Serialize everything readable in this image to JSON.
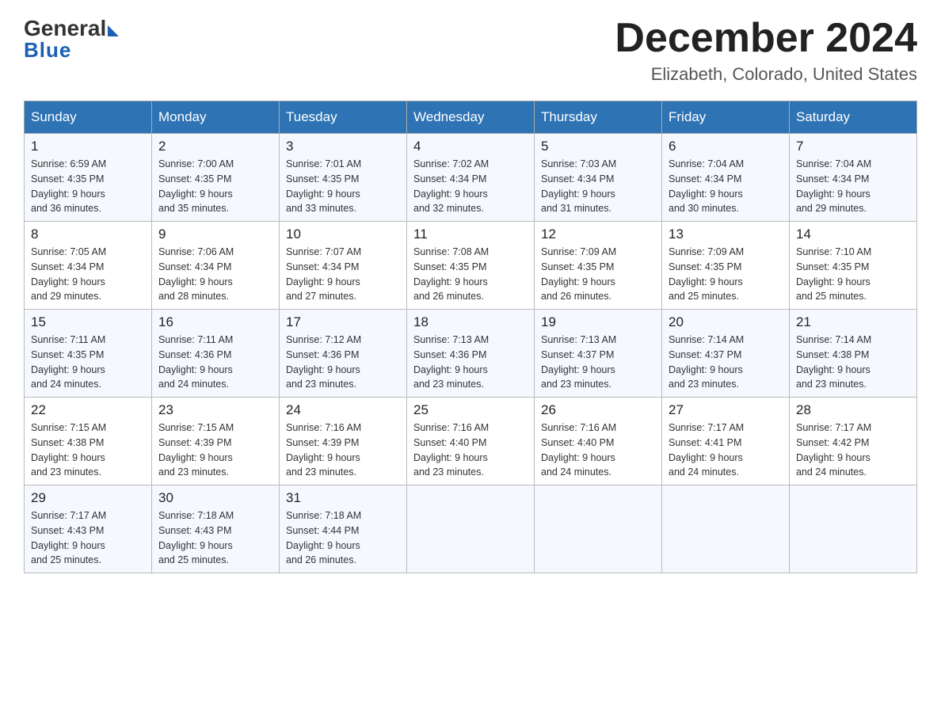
{
  "header": {
    "logo": {
      "general": "General",
      "blue": "Blue"
    },
    "title": "December 2024",
    "location": "Elizabeth, Colorado, United States"
  },
  "weekdays": [
    "Sunday",
    "Monday",
    "Tuesday",
    "Wednesday",
    "Thursday",
    "Friday",
    "Saturday"
  ],
  "weeks": [
    [
      {
        "day": "1",
        "sunrise": "Sunrise: 6:59 AM",
        "sunset": "Sunset: 4:35 PM",
        "daylight": "Daylight: 9 hours",
        "daylight2": "and 36 minutes."
      },
      {
        "day": "2",
        "sunrise": "Sunrise: 7:00 AM",
        "sunset": "Sunset: 4:35 PM",
        "daylight": "Daylight: 9 hours",
        "daylight2": "and 35 minutes."
      },
      {
        "day": "3",
        "sunrise": "Sunrise: 7:01 AM",
        "sunset": "Sunset: 4:35 PM",
        "daylight": "Daylight: 9 hours",
        "daylight2": "and 33 minutes."
      },
      {
        "day": "4",
        "sunrise": "Sunrise: 7:02 AM",
        "sunset": "Sunset: 4:34 PM",
        "daylight": "Daylight: 9 hours",
        "daylight2": "and 32 minutes."
      },
      {
        "day": "5",
        "sunrise": "Sunrise: 7:03 AM",
        "sunset": "Sunset: 4:34 PM",
        "daylight": "Daylight: 9 hours",
        "daylight2": "and 31 minutes."
      },
      {
        "day": "6",
        "sunrise": "Sunrise: 7:04 AM",
        "sunset": "Sunset: 4:34 PM",
        "daylight": "Daylight: 9 hours",
        "daylight2": "and 30 minutes."
      },
      {
        "day": "7",
        "sunrise": "Sunrise: 7:04 AM",
        "sunset": "Sunset: 4:34 PM",
        "daylight": "Daylight: 9 hours",
        "daylight2": "and 29 minutes."
      }
    ],
    [
      {
        "day": "8",
        "sunrise": "Sunrise: 7:05 AM",
        "sunset": "Sunset: 4:34 PM",
        "daylight": "Daylight: 9 hours",
        "daylight2": "and 29 minutes."
      },
      {
        "day": "9",
        "sunrise": "Sunrise: 7:06 AM",
        "sunset": "Sunset: 4:34 PM",
        "daylight": "Daylight: 9 hours",
        "daylight2": "and 28 minutes."
      },
      {
        "day": "10",
        "sunrise": "Sunrise: 7:07 AM",
        "sunset": "Sunset: 4:34 PM",
        "daylight": "Daylight: 9 hours",
        "daylight2": "and 27 minutes."
      },
      {
        "day": "11",
        "sunrise": "Sunrise: 7:08 AM",
        "sunset": "Sunset: 4:35 PM",
        "daylight": "Daylight: 9 hours",
        "daylight2": "and 26 minutes."
      },
      {
        "day": "12",
        "sunrise": "Sunrise: 7:09 AM",
        "sunset": "Sunset: 4:35 PM",
        "daylight": "Daylight: 9 hours",
        "daylight2": "and 26 minutes."
      },
      {
        "day": "13",
        "sunrise": "Sunrise: 7:09 AM",
        "sunset": "Sunset: 4:35 PM",
        "daylight": "Daylight: 9 hours",
        "daylight2": "and 25 minutes."
      },
      {
        "day": "14",
        "sunrise": "Sunrise: 7:10 AM",
        "sunset": "Sunset: 4:35 PM",
        "daylight": "Daylight: 9 hours",
        "daylight2": "and 25 minutes."
      }
    ],
    [
      {
        "day": "15",
        "sunrise": "Sunrise: 7:11 AM",
        "sunset": "Sunset: 4:35 PM",
        "daylight": "Daylight: 9 hours",
        "daylight2": "and 24 minutes."
      },
      {
        "day": "16",
        "sunrise": "Sunrise: 7:11 AM",
        "sunset": "Sunset: 4:36 PM",
        "daylight": "Daylight: 9 hours",
        "daylight2": "and 24 minutes."
      },
      {
        "day": "17",
        "sunrise": "Sunrise: 7:12 AM",
        "sunset": "Sunset: 4:36 PM",
        "daylight": "Daylight: 9 hours",
        "daylight2": "and 23 minutes."
      },
      {
        "day": "18",
        "sunrise": "Sunrise: 7:13 AM",
        "sunset": "Sunset: 4:36 PM",
        "daylight": "Daylight: 9 hours",
        "daylight2": "and 23 minutes."
      },
      {
        "day": "19",
        "sunrise": "Sunrise: 7:13 AM",
        "sunset": "Sunset: 4:37 PM",
        "daylight": "Daylight: 9 hours",
        "daylight2": "and 23 minutes."
      },
      {
        "day": "20",
        "sunrise": "Sunrise: 7:14 AM",
        "sunset": "Sunset: 4:37 PM",
        "daylight": "Daylight: 9 hours",
        "daylight2": "and 23 minutes."
      },
      {
        "day": "21",
        "sunrise": "Sunrise: 7:14 AM",
        "sunset": "Sunset: 4:38 PM",
        "daylight": "Daylight: 9 hours",
        "daylight2": "and 23 minutes."
      }
    ],
    [
      {
        "day": "22",
        "sunrise": "Sunrise: 7:15 AM",
        "sunset": "Sunset: 4:38 PM",
        "daylight": "Daylight: 9 hours",
        "daylight2": "and 23 minutes."
      },
      {
        "day": "23",
        "sunrise": "Sunrise: 7:15 AM",
        "sunset": "Sunset: 4:39 PM",
        "daylight": "Daylight: 9 hours",
        "daylight2": "and 23 minutes."
      },
      {
        "day": "24",
        "sunrise": "Sunrise: 7:16 AM",
        "sunset": "Sunset: 4:39 PM",
        "daylight": "Daylight: 9 hours",
        "daylight2": "and 23 minutes."
      },
      {
        "day": "25",
        "sunrise": "Sunrise: 7:16 AM",
        "sunset": "Sunset: 4:40 PM",
        "daylight": "Daylight: 9 hours",
        "daylight2": "and 23 minutes."
      },
      {
        "day": "26",
        "sunrise": "Sunrise: 7:16 AM",
        "sunset": "Sunset: 4:40 PM",
        "daylight": "Daylight: 9 hours",
        "daylight2": "and 24 minutes."
      },
      {
        "day": "27",
        "sunrise": "Sunrise: 7:17 AM",
        "sunset": "Sunset: 4:41 PM",
        "daylight": "Daylight: 9 hours",
        "daylight2": "and 24 minutes."
      },
      {
        "day": "28",
        "sunrise": "Sunrise: 7:17 AM",
        "sunset": "Sunset: 4:42 PM",
        "daylight": "Daylight: 9 hours",
        "daylight2": "and 24 minutes."
      }
    ],
    [
      {
        "day": "29",
        "sunrise": "Sunrise: 7:17 AM",
        "sunset": "Sunset: 4:43 PM",
        "daylight": "Daylight: 9 hours",
        "daylight2": "and 25 minutes."
      },
      {
        "day": "30",
        "sunrise": "Sunrise: 7:18 AM",
        "sunset": "Sunset: 4:43 PM",
        "daylight": "Daylight: 9 hours",
        "daylight2": "and 25 minutes."
      },
      {
        "day": "31",
        "sunrise": "Sunrise: 7:18 AM",
        "sunset": "Sunset: 4:44 PM",
        "daylight": "Daylight: 9 hours",
        "daylight2": "and 26 minutes."
      },
      null,
      null,
      null,
      null
    ]
  ]
}
